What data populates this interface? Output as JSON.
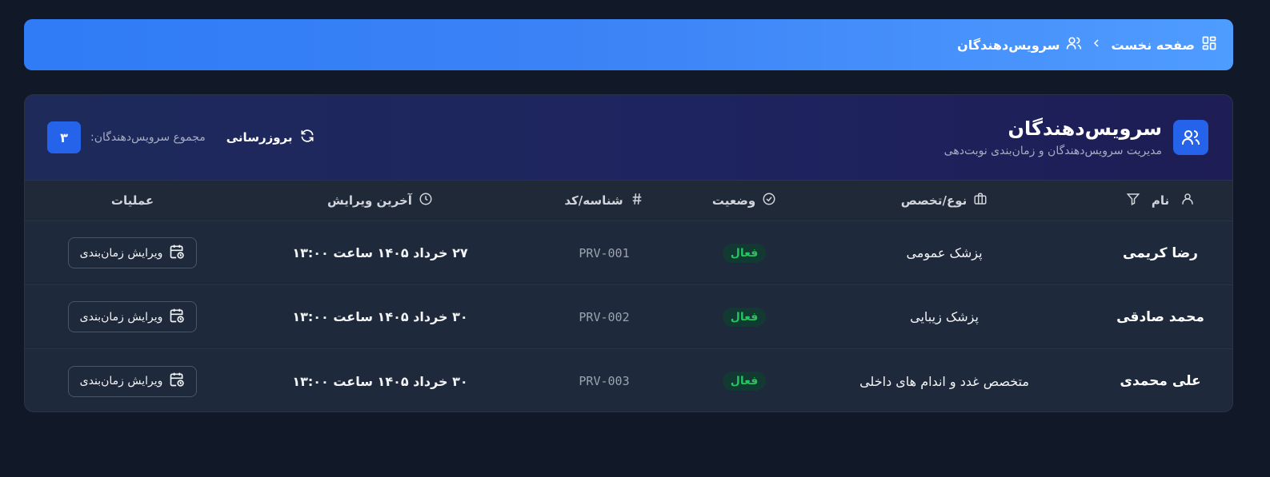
{
  "breadcrumb": {
    "home_label": "صفحه نخست",
    "home_icon": "dashboard-icon",
    "separator_icon": "chevron-left-icon",
    "current_label": "سرویس‌دهندگان",
    "current_icon": "users-icon"
  },
  "header": {
    "title": "سرویس‌دهندگان",
    "subtitle": "مدیریت سرویس‌دهندگان و زمان‌بندی نوبت‌دهی",
    "refresh_label": "بروزرسانی",
    "total_label": "مجموع سرویس‌دهندگان:",
    "total_count": "۳"
  },
  "table": {
    "columns": {
      "name": "نام",
      "type": "نوع/تخصص",
      "status": "وضعیت",
      "code": "شناسه/کد",
      "last_edit": "آخرین ویرایش",
      "ops": "عملیات"
    },
    "rows": [
      {
        "name": "رضا کریمی",
        "type": "پزشک عمومی",
        "status": "فعال",
        "code": "PRV-001",
        "last_edit": "۲۷ خرداد ۱۴۰۵ ساعت ۱۳:۰۰",
        "action": "ویرایش زمان‌بندی"
      },
      {
        "name": "محمد صادقی",
        "type": "پزشک زیبایی",
        "status": "فعال",
        "code": "PRV-002",
        "last_edit": "۳۰ خرداد ۱۴۰۵ ساعت ۱۳:۰۰",
        "action": "ویرایش زمان‌بندی"
      },
      {
        "name": "علی محمدی",
        "type": "متخصص غدد و اندام های داخلی",
        "status": "فعال",
        "code": "PRV-003",
        "last_edit": "۳۰ خرداد ۱۴۰۵ ساعت ۱۳:۰۰",
        "action": "ویرایش زمان‌بندی"
      }
    ]
  },
  "colors": {
    "background": "#111827",
    "accent": "#2563eb",
    "status_active": "#22c55e"
  }
}
